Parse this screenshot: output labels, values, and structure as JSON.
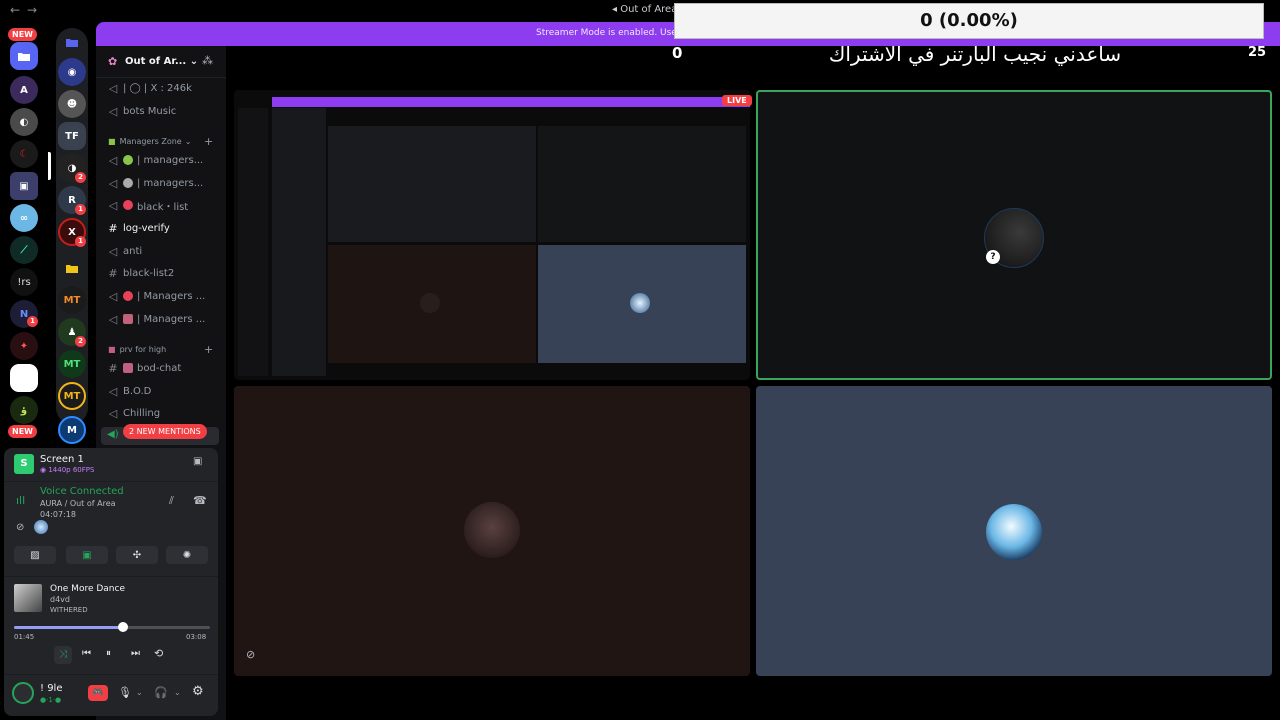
{
  "window": {
    "title": "Out of Area",
    "nav_back": "←",
    "nav_forward": "→"
  },
  "banner": {
    "text": "Streamer Mode is enabled. Userna"
  },
  "overlay": {
    "counter": "0  (0.00%)",
    "left_number": "0",
    "right_number": "25",
    "caption": "ساعدني نجيب البارتنر في الاشتراك"
  },
  "rail": {
    "new_top": "NEW",
    "new_bottom": "NEW",
    "badges": [
      "1",
      "2",
      "1",
      "1",
      "2"
    ],
    "text_icons": [
      "!rs",
      "MT",
      "MT",
      "MT",
      "N"
    ]
  },
  "server": {
    "name": "Out of Ar..."
  },
  "channels": [
    {
      "label": "| ◯ | X : 246k",
      "kind": "voice"
    },
    {
      "label": "bots Music",
      "kind": "voice"
    },
    {
      "label": "| managers...",
      "kind": "voice",
      "dot": "#86c64b"
    },
    {
      "label": "| managers...",
      "kind": "voice",
      "dot": "#aaaaaa"
    },
    {
      "label": "black・list",
      "kind": "voice",
      "dot": "#e8425a"
    },
    {
      "label": "log-verify",
      "kind": "text",
      "bright": true
    },
    {
      "label": "anti",
      "kind": "voice"
    },
    {
      "label": "black-list2",
      "kind": "text"
    },
    {
      "label": "| Managers ...",
      "kind": "voice",
      "dot": "#e8425a"
    },
    {
      "label": "| Managers ...",
      "kind": "voice",
      "dot": "#c0627a"
    },
    {
      "label": "bod-chat",
      "kind": "text",
      "dot": "#c06080"
    },
    {
      "label": "B.O.D",
      "kind": "voice"
    },
    {
      "label": "Chilling",
      "kind": "voice"
    }
  ],
  "categories": {
    "managers": "Managers Zone",
    "private": "prv for high"
  },
  "mentions": "2 NEW MENTIONS",
  "stream": {
    "title": "Screen 1",
    "quality": "1440p 60FPS"
  },
  "voice": {
    "status": "Voice Connected",
    "location": "AURA / Out of Area",
    "elapsed": "04:07:18"
  },
  "music": {
    "track": "One More Dance",
    "artist": "d4vd",
    "album": "WITHERED",
    "current": "01:45",
    "total": "03:08",
    "progress": 0.557
  },
  "user": {
    "name": "! 9le",
    "status": "●·1·●"
  },
  "tiles": {
    "live": "LIVE"
  },
  "colors": {
    "accent": "#8d3cf0",
    "voice_green": "#23a55a",
    "progress": "#949cf7",
    "tile_brown": "#211514",
    "tile_slate": "#374257",
    "tile_dark": "#111214"
  }
}
